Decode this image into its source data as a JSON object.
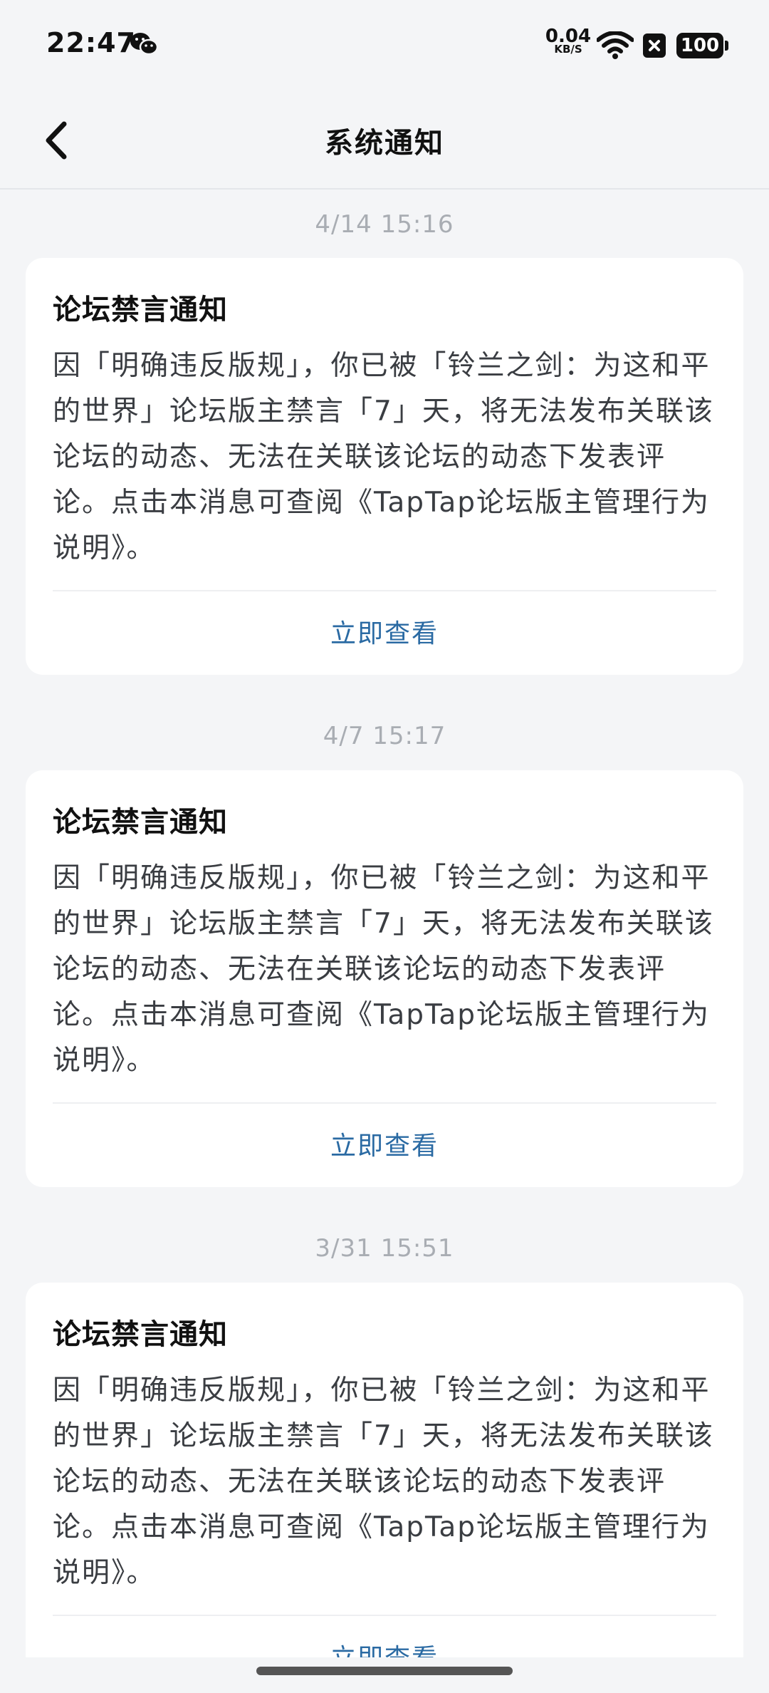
{
  "status_bar": {
    "time": "22:47",
    "net_speed_value": "0.04",
    "net_speed_unit": "KB/S",
    "battery_level": "100",
    "icons": [
      "wechat-icon",
      "wifi-icon",
      "x-icon",
      "battery-icon"
    ]
  },
  "nav": {
    "title": "系统通知",
    "back_icon": "chevron-left-icon"
  },
  "notifications": [
    {
      "timestamp": "4/14  15:16",
      "title": "论坛禁言通知",
      "body": "因「明确违反版规」，你已被「铃兰之剑：为这和平的世界」论坛版主禁言「7」天，将无法发布关联该论坛的动态、无法在关联该论坛的动态下发表评论。点击本消息可查阅《TapTap论坛版主管理行为说明》。",
      "action_label": "立即查看"
    },
    {
      "timestamp": "4/7  15:17",
      "title": "论坛禁言通知",
      "body": "因「明确违反版规」，你已被「铃兰之剑：为这和平的世界」论坛版主禁言「7」天，将无法发布关联该论坛的动态、无法在关联该论坛的动态下发表评论。点击本消息可查阅《TapTap论坛版主管理行为说明》。",
      "action_label": "立即查看"
    },
    {
      "timestamp": "3/31  15:51",
      "title": "论坛禁言通知",
      "body": "因「明确违反版规」，你已被「铃兰之剑：为这和平的世界」论坛版主禁言「7」天，将无法发布关联该论坛的动态、无法在关联该论坛的动态下发表评论。点击本消息可查阅《TapTap论坛版主管理行为说明》。",
      "action_label": "立即查看"
    }
  ],
  "colors": {
    "background": "#f4f5f7",
    "card": "#ffffff",
    "action_link": "#2a6aa3",
    "timestamp": "#a9adb3"
  }
}
